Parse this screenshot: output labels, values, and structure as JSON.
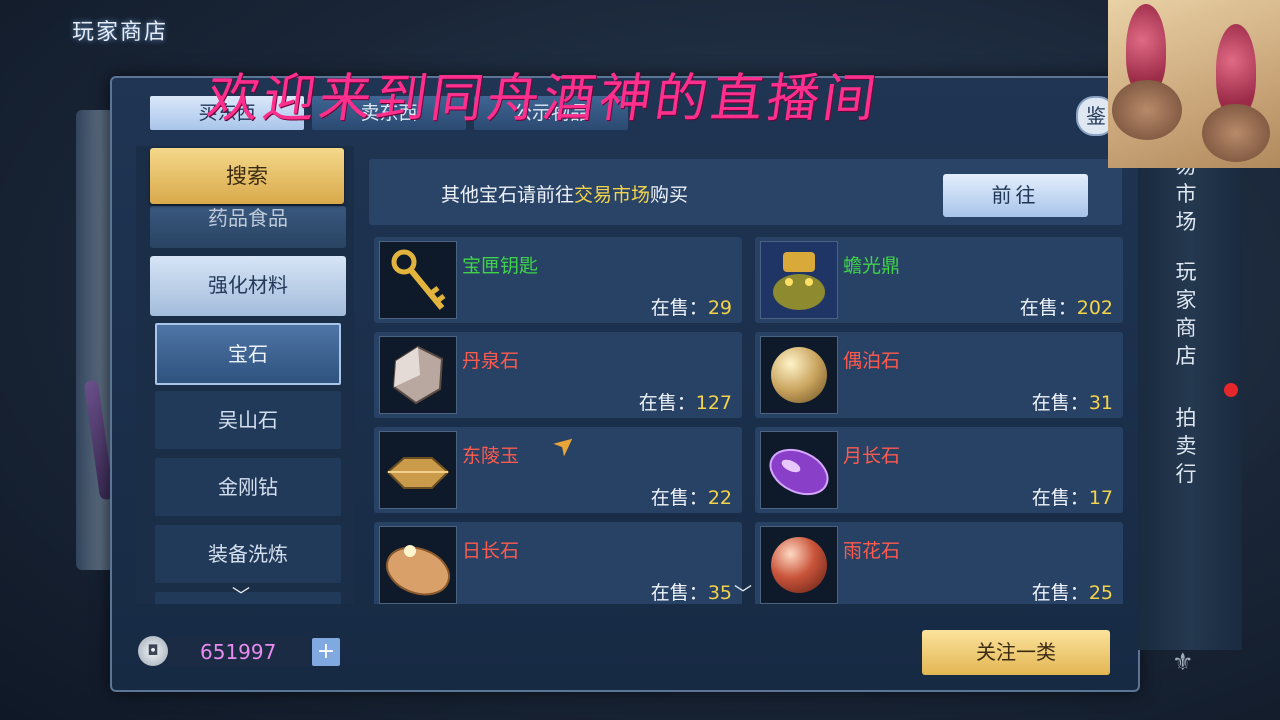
{
  "header": {
    "title": "玩家商店"
  },
  "overlay": {
    "banner": "欢迎来到同舟酒神的直播间"
  },
  "tabs": [
    {
      "label": "买东西",
      "active": true
    },
    {
      "label": "卖东西",
      "active": false
    },
    {
      "label": "公示物品",
      "active": false
    }
  ],
  "appraise_icon_glyph": "鉴",
  "sidebar": {
    "search_label": "搜索",
    "categories": [
      {
        "label": "药品食品"
      },
      {
        "label": "强化材料",
        "selected": true
      }
    ],
    "subcategories": [
      {
        "label": "宝石",
        "selected": true
      },
      {
        "label": "吴山石"
      },
      {
        "label": "金刚钻"
      },
      {
        "label": "装备洗炼"
      }
    ]
  },
  "notice": {
    "prefix": "其他宝石请前往",
    "link": "交易市场",
    "suffix": "购买",
    "goto_label": "前往"
  },
  "items": [
    {
      "name": "宝匣钥匙",
      "on_sale_label": "在售：",
      "count": "29",
      "name_color": "#3fd24a"
    },
    {
      "name": "蟾光鼎",
      "on_sale_label": "在售：",
      "count": "202",
      "name_color": "#3fd24a"
    },
    {
      "name": "丹泉石",
      "on_sale_label": "在售：",
      "count": "127",
      "name_color": "#ff5a4e"
    },
    {
      "name": "偶泊石",
      "on_sale_label": "在售：",
      "count": "31",
      "name_color": "#ff5a4e"
    },
    {
      "name": "东陵玉",
      "on_sale_label": "在售：",
      "count": "22",
      "name_color": "#ff5a4e"
    },
    {
      "name": "月长石",
      "on_sale_label": "在售：",
      "count": "17",
      "name_color": "#ff5a4e"
    },
    {
      "name": "日长石",
      "on_sale_label": "在售：",
      "count": "35",
      "name_color": "#ff5a4e"
    },
    {
      "name": "雨花石",
      "on_sale_label": "在售：",
      "count": "25",
      "name_color": "#ff5a4e"
    }
  ],
  "footer": {
    "currency_value": "651997",
    "add_glyph": "+",
    "follow_label": "关注一类"
  },
  "side_nav": {
    "market": "易市场",
    "shop": "玩家商店",
    "auction": "拍卖行"
  },
  "colors": {
    "accent_gold": "#f3d34a",
    "banner_pink": "#ff2f8e",
    "currency_pink": "#e88cf0"
  }
}
